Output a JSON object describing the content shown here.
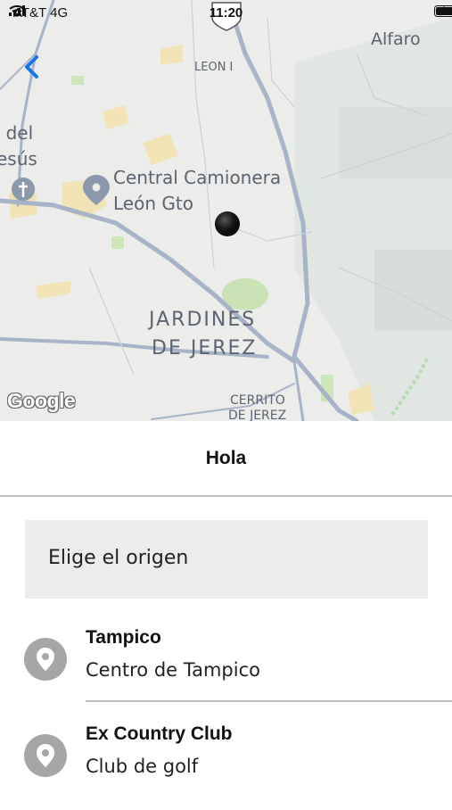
{
  "status_bar": {
    "carrier": "AT&T 4G",
    "time": "11:20"
  },
  "map": {
    "labels": {
      "alfaro": "Alfaro",
      "leon_i": "LEON I",
      "del": "o del",
      "jesus": "esús",
      "central_line1": "Central Camionera",
      "central_line2": "León Gto",
      "jardines_line1": "JARDINES",
      "jardines_line2": "DE JEREZ",
      "cerrito_line1": "CERRITO",
      "cerrito_line2": "DE JEREZ",
      "google": "Google"
    }
  },
  "header": {
    "title": "Hola"
  },
  "origin": {
    "label": "Elige el origen"
  },
  "places": [
    {
      "name": "Tampico",
      "subtitle": "Centro de Tampico"
    },
    {
      "name": "Ex Country Club",
      "subtitle": "Club de golf"
    }
  ],
  "icons": {
    "back": "chevron-left-icon",
    "place": "location-pin-icon",
    "marker": "map-marker-icon"
  },
  "colors": {
    "accent": "#1a73e8",
    "pin": "#a6a6a6",
    "map_bg": "#ececea",
    "road": "#a6b3c8"
  }
}
